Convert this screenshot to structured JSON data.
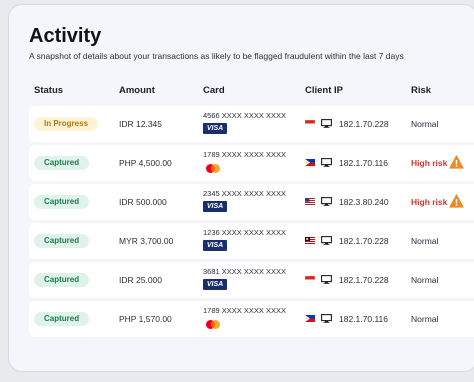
{
  "header": {
    "title": "Activity",
    "subtitle": "A snapshot of details about your transactions as likely to be flagged fraudulent within the last 7 days"
  },
  "columns": {
    "status": "Status",
    "amount": "Amount",
    "card": "Card",
    "client_ip": "Client IP",
    "risk": "Risk"
  },
  "rows": [
    {
      "status": "In Progress",
      "status_kind": "progress",
      "amount": "IDR 12.345",
      "card_number": "4566 XXXX XXXX XXXX",
      "card_brand": "VISA",
      "flag": "indonesia",
      "ip": "182.1.70.228",
      "risk": "Normal",
      "risk_level": "normal"
    },
    {
      "status": "Captured",
      "status_kind": "captured",
      "amount": "PHP 4,500.00",
      "card_number": "1789 XXXX XXXX XXXX",
      "card_brand": "mastercard",
      "flag": "philippines",
      "ip": "182.1.70.116",
      "risk": "High risk",
      "risk_level": "high"
    },
    {
      "status": "Captured",
      "status_kind": "captured",
      "amount": "IDR 500.000",
      "card_number": "2345 XXXX XXXX XXXX",
      "card_brand": "VISA",
      "flag": "usa",
      "ip": "182.3.80.240",
      "risk": "High risk",
      "risk_level": "high"
    },
    {
      "status": "Captured",
      "status_kind": "captured",
      "amount": "MYR 3,700.00",
      "card_number": "1236 XXXX XXXX XXXX",
      "card_brand": "VISA",
      "flag": "malaysia",
      "ip": "182.1.70.228",
      "risk": "Normal",
      "risk_level": "normal"
    },
    {
      "status": "Captured",
      "status_kind": "captured",
      "amount": "IDR 25.000",
      "card_number": "3681 XXXX XXXX XXXX",
      "card_brand": "VISA",
      "flag": "indonesia",
      "ip": "182.1.70.228",
      "risk": "Normal",
      "risk_level": "normal"
    },
    {
      "status": "Captured",
      "status_kind": "captured",
      "amount": "PHP 1,570.00",
      "card_number": "1789 XXXX XXXX XXXX",
      "card_brand": "mastercard",
      "flag": "philippines",
      "ip": "182.1.70.116",
      "risk": "Normal",
      "risk_level": "normal"
    }
  ],
  "colors": {
    "high_risk": "#d8342c",
    "progress_badge": "#fff3d6",
    "captured_badge": "#dff3ea",
    "visa": "#1a2e6e"
  },
  "icons": {
    "monitor": "monitor-icon",
    "warning": "warning-icon"
  }
}
